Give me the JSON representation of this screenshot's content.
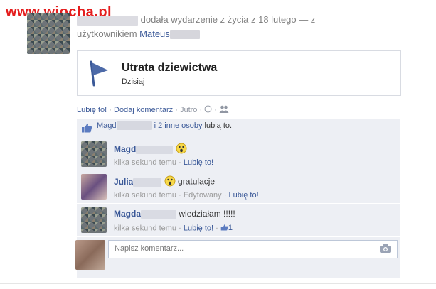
{
  "watermark": "www.wiocha.pl",
  "story": {
    "action_text": "dodała wydarzenie z życia z 18 lutego — z",
    "with_text": "użytkownikiem",
    "tagged_name": "Mateus"
  },
  "event": {
    "title": "Utrata dziewictwa",
    "date": "Dzisiaj",
    "icon": "flag-icon"
  },
  "actions": {
    "like": "Lubię to!",
    "comment": "Dodaj komentarz",
    "time": "Jutro",
    "separator": "·"
  },
  "likes": {
    "name": "Magd",
    "rest": "i 2 inne osoby",
    "suffix": "lubią to."
  },
  "comments": [
    {
      "name": "Magd",
      "text": "",
      "time": "kilka sekund temu",
      "extra": "",
      "like": "Lubię to!",
      "like_count": ""
    },
    {
      "name": "Julia",
      "text": "gratulacje",
      "time": "kilka sekund temu",
      "extra": "Edytowany",
      "like": "Lubię to!",
      "like_count": ""
    },
    {
      "name": "Magda",
      "text": "wiedziałam !!!!!",
      "time": "kilka sekund temu",
      "extra": "",
      "like": "Lubię to!",
      "like_count": "1"
    }
  ],
  "composer": {
    "placeholder": "Napisz komentarz..."
  },
  "colors": {
    "link": "#3b5998",
    "panel_bg": "#edeff4",
    "watermark": "#e41d1d"
  }
}
